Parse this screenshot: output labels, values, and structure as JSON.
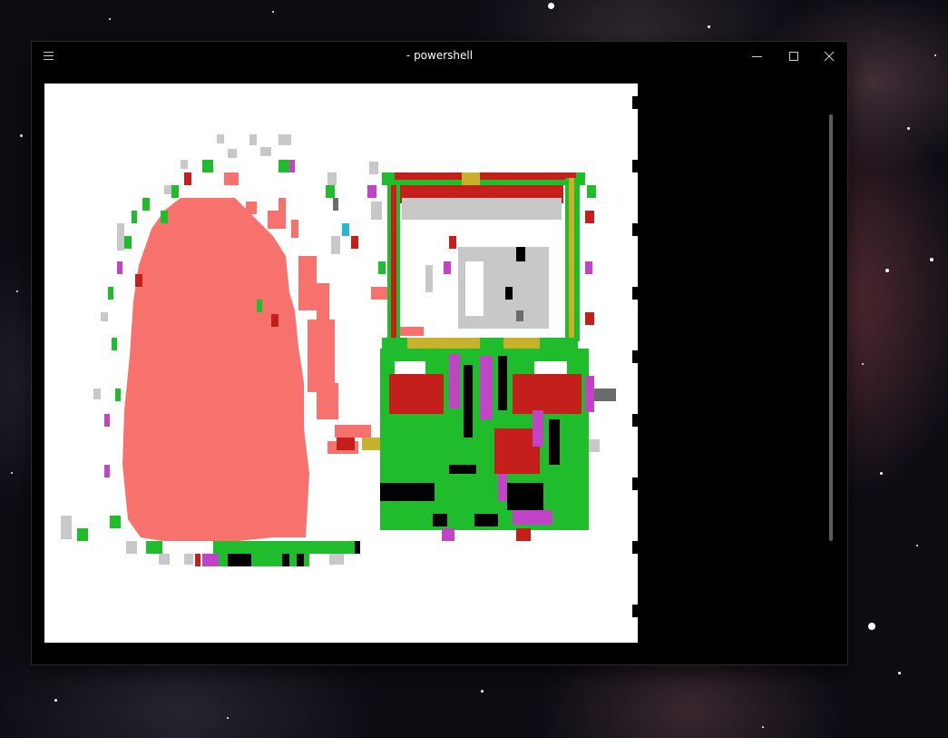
{
  "window": {
    "title": "- powershell"
  },
  "titlebar": {
    "menu_icon": "hamburger-menu-icon",
    "minimize_icon": "minimize-icon",
    "maximize_icon": "maximize-icon",
    "close_icon": "close-icon"
  },
  "colors": {
    "terminal_bg": "#000000",
    "content_bg": "#ffffff",
    "salmon": "#f7726c",
    "green": "#1fbd2c",
    "red": "#c41f1a",
    "magenta": "#c144c6",
    "gold": "#c8b12b",
    "gray": "#c8c8c8",
    "dark_gray": "#6b6b6b",
    "cyan": "#2bb5d8"
  }
}
